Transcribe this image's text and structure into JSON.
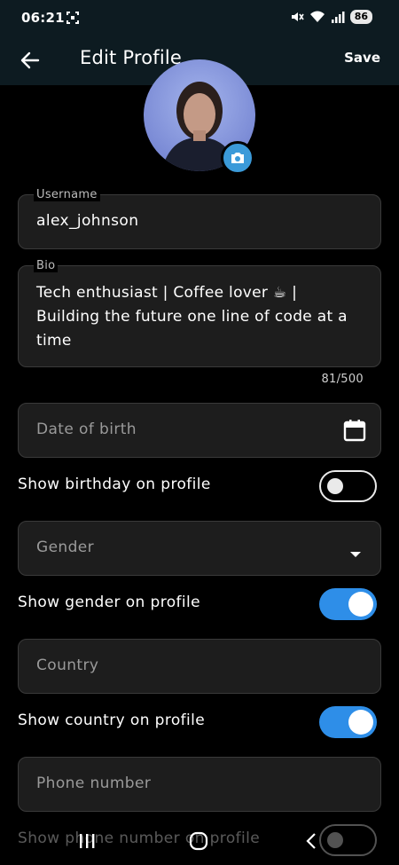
{
  "status_bar": {
    "time": "06:21",
    "battery": "86"
  },
  "app_bar": {
    "title": "Edit Profile",
    "save_label": "Save"
  },
  "avatar": {
    "alt": "profile photo"
  },
  "username": {
    "label": "Username",
    "value": "alex_johnson"
  },
  "bio": {
    "label": "Bio",
    "value": "Tech enthusiast | Coffee lover ☕ | Building the future one line of code at a time",
    "counter": "81/500"
  },
  "dob": {
    "placeholder": "Date of birth"
  },
  "show_birthday": {
    "label": "Show birthday on profile",
    "on": false
  },
  "gender": {
    "placeholder": "Gender"
  },
  "show_gender": {
    "label": "Show gender on profile",
    "on": true
  },
  "country": {
    "placeholder": "Country"
  },
  "show_country": {
    "label": "Show country on profile",
    "on": true
  },
  "phone": {
    "placeholder": "Phone number"
  },
  "show_phone": {
    "label": "Show phone number on profile",
    "on": false
  },
  "colors": {
    "accent": "#2e8ee8",
    "appbar": "#0d1b21",
    "field_bg": "#1d1d1d"
  }
}
